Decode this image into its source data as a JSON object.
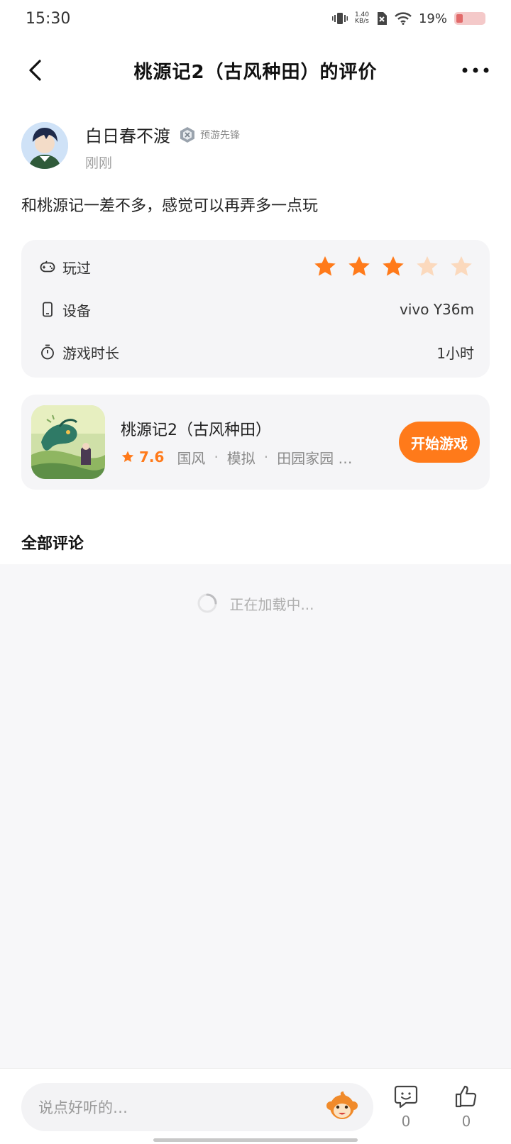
{
  "status_bar": {
    "time": "15:30",
    "net_speed_value": "1.40",
    "net_speed_unit": "KB/s",
    "battery": "19%"
  },
  "header": {
    "title": "桃源记2（古风种田）的评价"
  },
  "review": {
    "username": "白日春不渡",
    "badge": "预游先锋",
    "time": "刚刚",
    "text": "和桃源记一差不多，感觉可以再弄多一点玩"
  },
  "info": {
    "played_label": "玩过",
    "rating_stars": 3,
    "max_stars": 5,
    "device_label": "设备",
    "device_value": "vivo Y36m",
    "duration_label": "游戏时长",
    "duration_value": "1小时"
  },
  "game": {
    "name": "桃源记2（古风种田）",
    "score": "7.6",
    "tags": [
      "国风",
      "模拟",
      "田园家园 …"
    ],
    "play_label": "开始游戏"
  },
  "comments": {
    "section_title": "全部评论",
    "loading_text": "正在加载中..."
  },
  "bottom": {
    "input_placeholder": "说点好听的…",
    "comment_count": "0",
    "like_count": "0"
  },
  "colors": {
    "accent": "#ff7a1a",
    "star_inactive": "#fbd9bd",
    "card_bg": "#f5f5f7"
  }
}
